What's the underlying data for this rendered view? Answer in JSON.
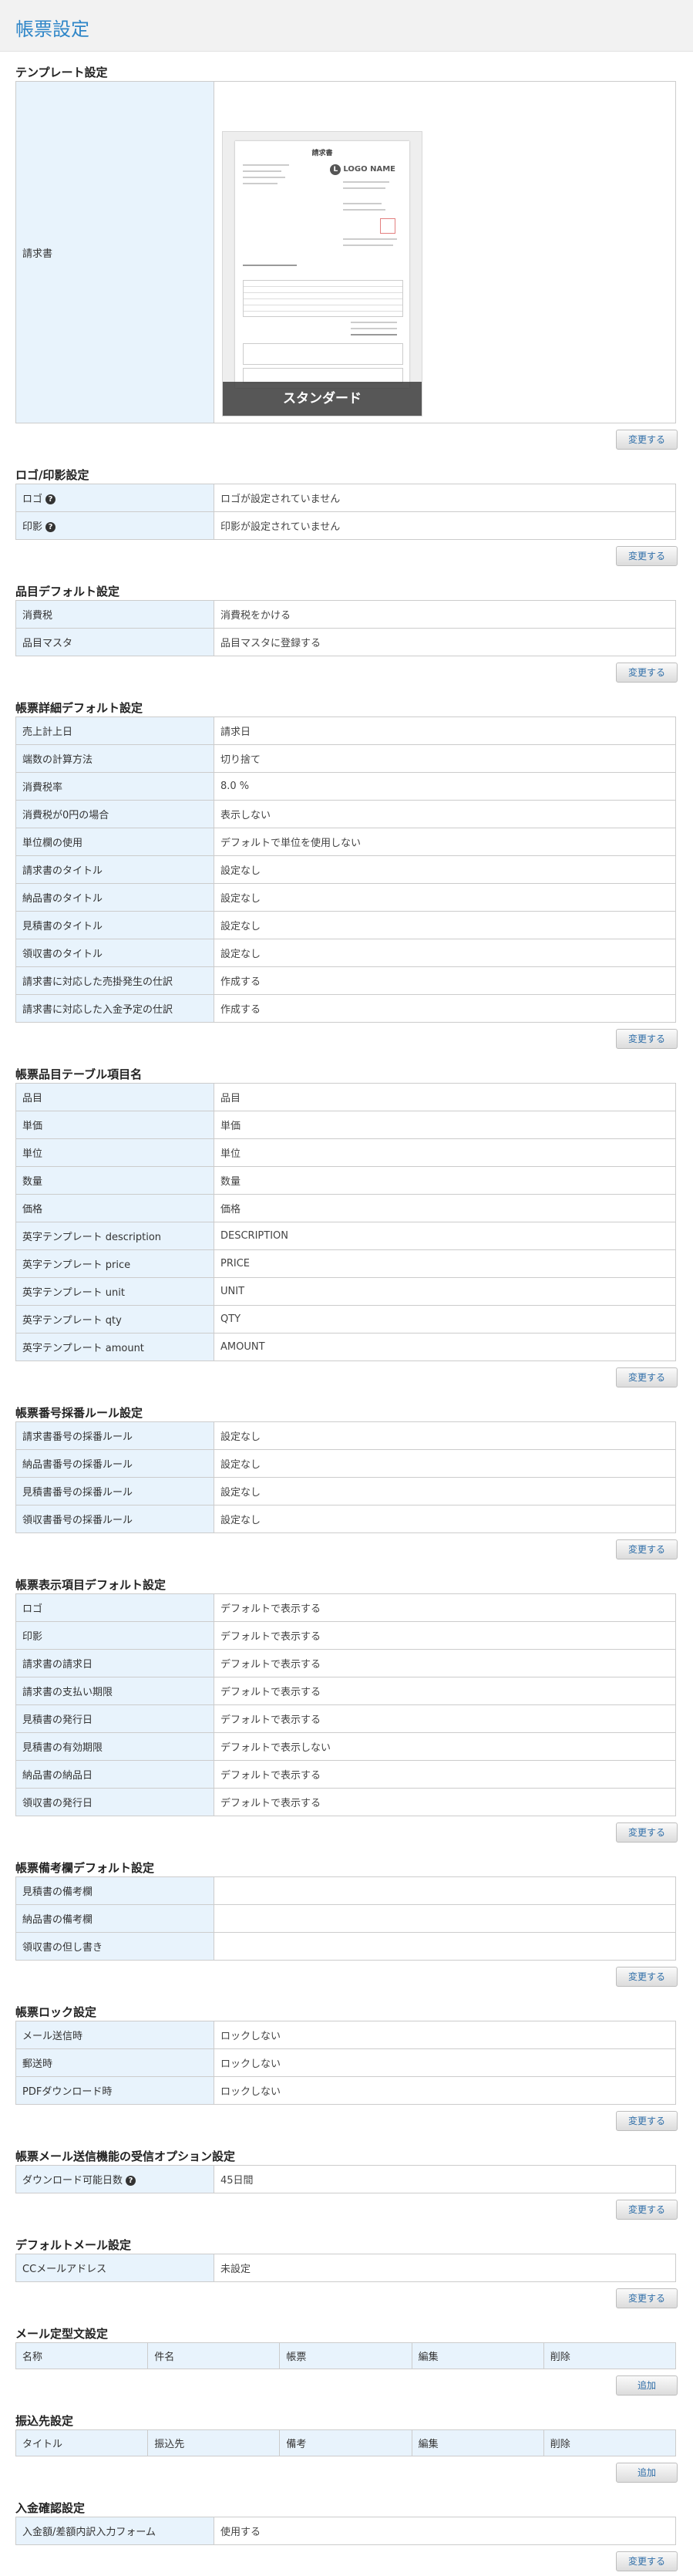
{
  "page_title": "帳票設定",
  "change_label": "変更する",
  "add_label": "追加",
  "template": {
    "title": "テンプレート設定",
    "label": "請求書",
    "preview_label": "スタンダード",
    "doc_title": "請求書",
    "logo_text": "LOGO NAME",
    "logo_letter": "L"
  },
  "logo": {
    "title": "ロゴ/印影設定",
    "rows": [
      {
        "key": "ロゴ",
        "value": "ロゴが設定されていません"
      },
      {
        "key": "印影",
        "value": "印影が設定されていません"
      }
    ],
    "help_icon": "question-circle-icon"
  },
  "item_default": {
    "title": "品目デフォルト設定",
    "rows": [
      {
        "key": "消費税",
        "value": "消費税をかける"
      },
      {
        "key": "品目マスタ",
        "value": "品目マスタに登録する"
      }
    ]
  },
  "detail_default": {
    "title": "帳票詳細デフォルト設定",
    "rows": [
      {
        "key": "売上計上日",
        "value": "請求日"
      },
      {
        "key": "端数の計算方法",
        "value": "切り捨て"
      },
      {
        "key": "消費税率",
        "value": "8.0 %"
      },
      {
        "key": "消費税が0円の場合",
        "value": "表示しない"
      },
      {
        "key": "単位欄の使用",
        "value": "デフォルトで単位を使用しない"
      },
      {
        "key": "請求書のタイトル",
        "value": "設定なし"
      },
      {
        "key": "納品書のタイトル",
        "value": "設定なし"
      },
      {
        "key": "見積書のタイトル",
        "value": "設定なし"
      },
      {
        "key": "領収書のタイトル",
        "value": "設定なし"
      },
      {
        "key": "請求書に対応した売掛発生の仕訳",
        "value": "作成する"
      },
      {
        "key": "請求書に対応した入金予定の仕訳",
        "value": "作成する"
      }
    ]
  },
  "table_columns": {
    "title": "帳票品目テーブル項目名",
    "rows": [
      {
        "key": "品目",
        "value": "品目"
      },
      {
        "key": "単価",
        "value": "単価"
      },
      {
        "key": "単位",
        "value": "単位"
      },
      {
        "key": "数量",
        "value": "数量"
      },
      {
        "key": "価格",
        "value": "価格"
      },
      {
        "key": "英字テンプレート description",
        "value": "DESCRIPTION"
      },
      {
        "key": "英字テンプレート price",
        "value": "PRICE"
      },
      {
        "key": "英字テンプレート unit",
        "value": "UNIT"
      },
      {
        "key": "英字テンプレート qty",
        "value": "QTY"
      },
      {
        "key": "英字テンプレート amount",
        "value": "AMOUNT"
      }
    ]
  },
  "numbering": {
    "title": "帳票番号採番ルール設定",
    "rows": [
      {
        "key": "請求書番号の採番ルール",
        "value": "設定なし"
      },
      {
        "key": "納品書番号の採番ルール",
        "value": "設定なし"
      },
      {
        "key": "見積書番号の採番ルール",
        "value": "設定なし"
      },
      {
        "key": "領収書番号の採番ルール",
        "value": "設定なし"
      }
    ]
  },
  "display_default": {
    "title": "帳票表示項目デフォルト設定",
    "rows": [
      {
        "key": "ロゴ",
        "value": "デフォルトで表示する"
      },
      {
        "key": "印影",
        "value": "デフォルトで表示する"
      },
      {
        "key": "請求書の請求日",
        "value": "デフォルトで表示する"
      },
      {
        "key": "請求書の支払い期限",
        "value": "デフォルトで表示する"
      },
      {
        "key": "見積書の発行日",
        "value": "デフォルトで表示する"
      },
      {
        "key": "見積書の有効期限",
        "value": "デフォルトで表示しない"
      },
      {
        "key": "納品書の納品日",
        "value": "デフォルトで表示する"
      },
      {
        "key": "領収書の発行日",
        "value": "デフォルトで表示する"
      }
    ]
  },
  "remarks_default": {
    "title": "帳票備考欄デフォルト設定",
    "rows": [
      {
        "key": "見積書の備考欄",
        "value": ""
      },
      {
        "key": "納品書の備考欄",
        "value": ""
      },
      {
        "key": "領収書の但し書き",
        "value": ""
      }
    ]
  },
  "lock": {
    "title": "帳票ロック設定",
    "rows": [
      {
        "key": "メール送信時",
        "value": "ロックしない"
      },
      {
        "key": "郵送時",
        "value": "ロックしない"
      },
      {
        "key": "PDFダウンロード時",
        "value": "ロックしない"
      }
    ]
  },
  "mail_option": {
    "title": "帳票メール送信機能の受信オプション設定",
    "rows": [
      {
        "key": "ダウンロード可能日数",
        "value": "45日間"
      }
    ]
  },
  "default_mail": {
    "title": "デフォルトメール設定",
    "rows": [
      {
        "key": "CCメールアドレス",
        "value": "未設定"
      }
    ]
  },
  "mail_template": {
    "title": "メール定型文設定",
    "headers": [
      "名称",
      "件名",
      "帳票",
      "編集",
      "削除"
    ]
  },
  "transfer": {
    "title": "振込先設定",
    "headers": [
      "タイトル",
      "振込先",
      "備考",
      "編集",
      "削除"
    ]
  },
  "payment_confirm": {
    "title": "入金確認設定",
    "rows": [
      {
        "key": "入金額/差額内訳入力フォーム",
        "value": "使用する"
      }
    ]
  }
}
